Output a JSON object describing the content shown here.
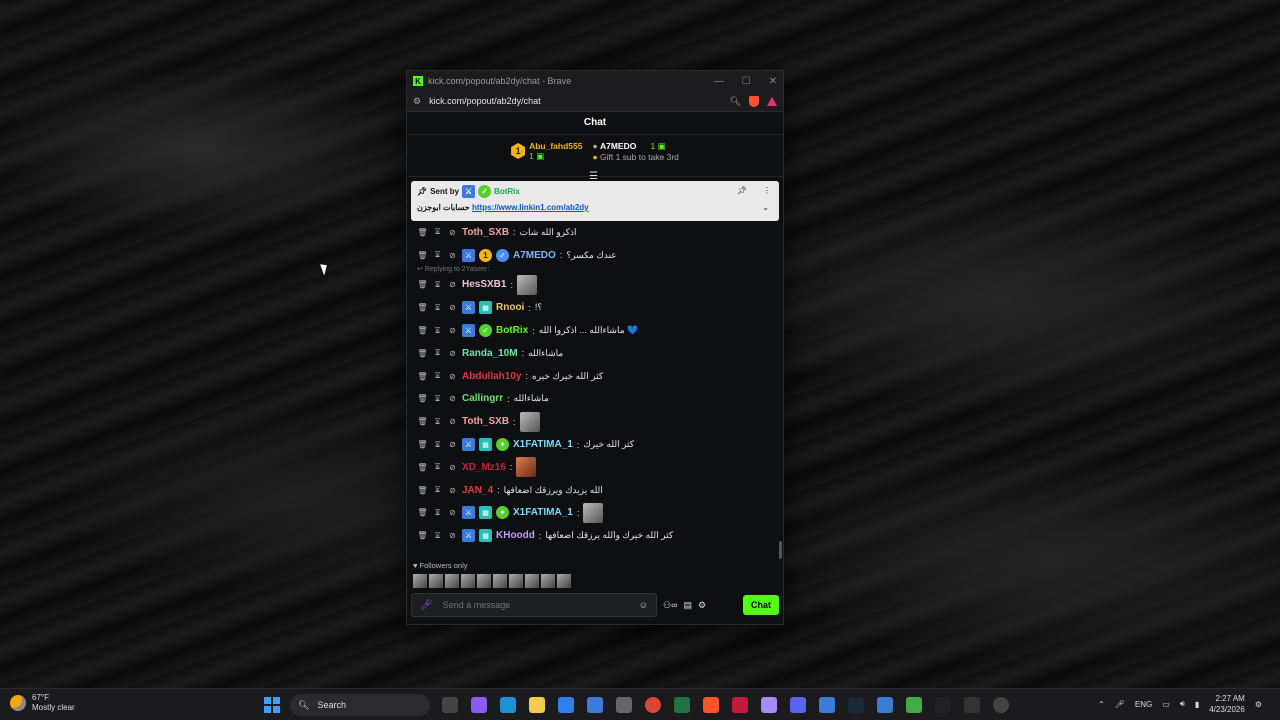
{
  "window": {
    "title": "kick.com/popout/ab2dy/chat - Brave",
    "url": "kick.com/popout/ab2dy/chat"
  },
  "chat": {
    "header": "Chat",
    "leaderboard": [
      {
        "name": "Abu_fahd555",
        "count": "1",
        "rank": "1"
      },
      {
        "name": "A7MEDO",
        "count": "1",
        "note": "Gift 1 sub to take 3rd"
      }
    ],
    "pinned": {
      "sent_by_label": "Sent by",
      "sender": "BotRix",
      "message_prefix": "حسابات ابوجزن",
      "link": "https://www.linkin1.com/ab2dy"
    },
    "reply_hint": "Replying to 2Yaseer:",
    "messages": [
      {
        "user": "Toth_SXB",
        "color": "#f4a0a0",
        "badges": [],
        "text": "اذكرو الله شات"
      },
      {
        "user": "A7MEDO",
        "color": "#7fb4ff",
        "badges": [
          "blue",
          "gold",
          "verified"
        ],
        "text": "عندك مكسر؟"
      },
      {
        "user": "HesSXB1",
        "color": "#f2c0d8",
        "badges": [],
        "text": "",
        "emote": true
      },
      {
        "user": "Rnooi",
        "color": "#f5c26b",
        "badges": [
          "blue",
          "cyan"
        ],
        "text": "!؟"
      },
      {
        "user": "BotRix",
        "color": "#53fc18",
        "badges": [
          "blue",
          "green"
        ],
        "text": "ماشاءالله ... اذكروا الله 💙"
      },
      {
        "user": "Randa_10M",
        "color": "#6ee3b0",
        "badges": [],
        "text": "ماشاءالله"
      },
      {
        "user": "Abdullah10y",
        "color": "#e0334d",
        "badges": [],
        "text": "كثر الله خيرك خيره"
      },
      {
        "user": "Callingrr",
        "color": "#6ee36e",
        "badges": [],
        "text": "ماشاءالله"
      },
      {
        "user": "Toth_SXB",
        "color": "#f4a0a0",
        "badges": [],
        "text": "",
        "emote": true
      },
      {
        "user": "X1FATIMA_1",
        "color": "#7fd9ff",
        "badges": [
          "blue",
          "cyan",
          "green"
        ],
        "text": "كثر الله خيرك"
      },
      {
        "user": "XD_Mz16",
        "color": "#c2243a",
        "badges": [],
        "text": "",
        "emote": true
      },
      {
        "user": "JAN_4",
        "color": "#e03a3a",
        "badges": [],
        "text": "الله يزيدك ويرزقك اضعافها"
      },
      {
        "user": "X1FATIMA_1",
        "color": "#7fd9ff",
        "badges": [
          "blue",
          "cyan",
          "green"
        ],
        "text": "",
        "emote": true
      },
      {
        "user": "KHoodd",
        "color": "#c39bff",
        "badges": [
          "blue",
          "cyan"
        ],
        "text": "كثر الله خيرك والله يرزقك اضعافها"
      }
    ],
    "followers_only": "Followers only",
    "input_placeholder": "Send a message",
    "send_label": "Chat"
  },
  "taskbar": {
    "temperature": "67°F",
    "weather": "Mostly clear",
    "search": "Search",
    "language": "ENG",
    "time": "2:27 AM",
    "date": "4/23/2026"
  }
}
